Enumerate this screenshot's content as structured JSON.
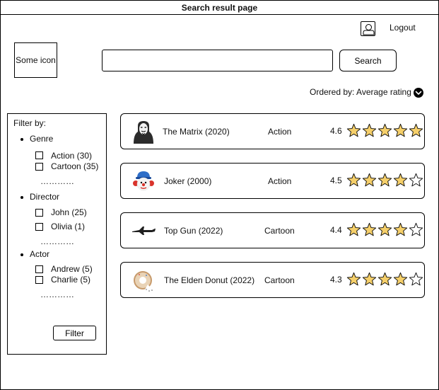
{
  "page_title": "Search result page",
  "header": {
    "logout_label": "Logout",
    "logo_text": "Some icon",
    "search_placeholder": "",
    "search_button": "Search"
  },
  "ordering": {
    "label": "Ordered by: Average rating"
  },
  "filter": {
    "heading": "Filter by:",
    "groups": [
      {
        "name": "Genre",
        "options": [
          "Action (30)",
          "Cartoon (35)"
        ],
        "more": "…………"
      },
      {
        "name": "Director",
        "options": [
          "John (25)",
          "Olivia (1)"
        ],
        "more": "…………"
      },
      {
        "name": "Actor",
        "options": [
          "Andrew (5)",
          "Charlie (5)"
        ],
        "more": "…………"
      }
    ],
    "button_label": "Filter"
  },
  "results": [
    {
      "title": "The Matrix (2020)",
      "genre": "Action",
      "rating": "4.6",
      "stars_filled": 5,
      "icon": "anonymous-mask-icon"
    },
    {
      "title": "Joker (2000)",
      "genre": "Action",
      "rating": "4.5",
      "stars_filled": 4,
      "icon": "clown-icon"
    },
    {
      "title": "Top Gun (2022)",
      "genre": "Cartoon",
      "rating": "4.4",
      "stars_filled": 4,
      "icon": "fighter-jet-icon"
    },
    {
      "title": "The Elden Donut (2022)",
      "genre": "Cartoon",
      "rating": "4.3",
      "stars_filled": 4,
      "icon": "donut-icon"
    }
  ],
  "colors": {
    "star_fill": "#f5cf6a",
    "star_empty": "#ffffff",
    "border": "#000000"
  }
}
